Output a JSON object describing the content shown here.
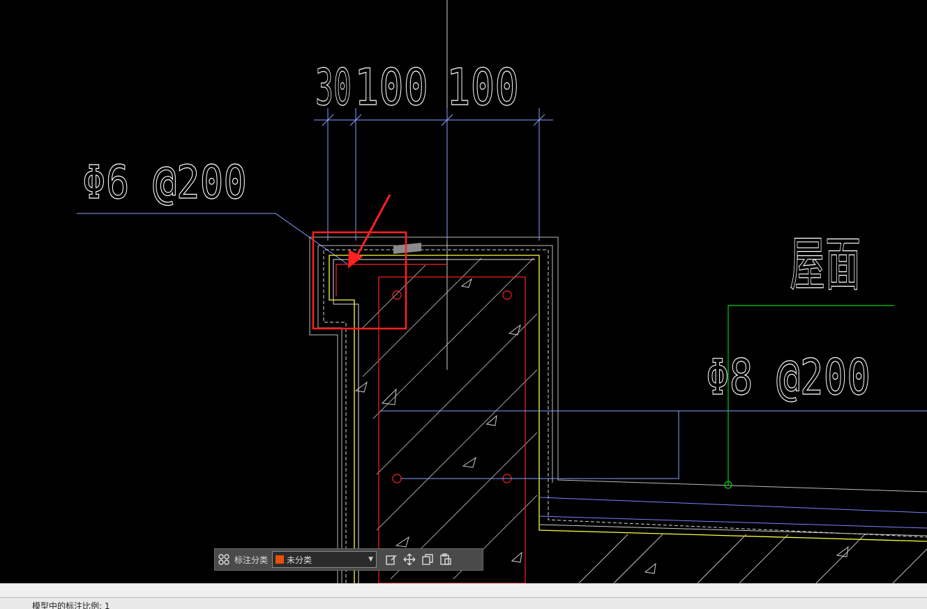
{
  "drawing": {
    "dims": [
      "30",
      "100",
      "100"
    ],
    "rebar_labels": {
      "top_left": "Φ6 @200",
      "right": "Φ8 @200"
    },
    "room_label": "屋面"
  },
  "toolbar": {
    "category_label": "标注分类",
    "category_value": "未分类",
    "category_color": "#e8500a",
    "icons": [
      "grid-icon",
      "edit-icon",
      "move-icon",
      "copy-icon",
      "paste-icon"
    ]
  },
  "status": {
    "text": "模型中的标注比例: 1"
  },
  "colors": {
    "highlight": "#ff2020",
    "dimension": "#8aa0ff",
    "leader_green": "#00d000",
    "finish_yellow": "#ffff40"
  }
}
